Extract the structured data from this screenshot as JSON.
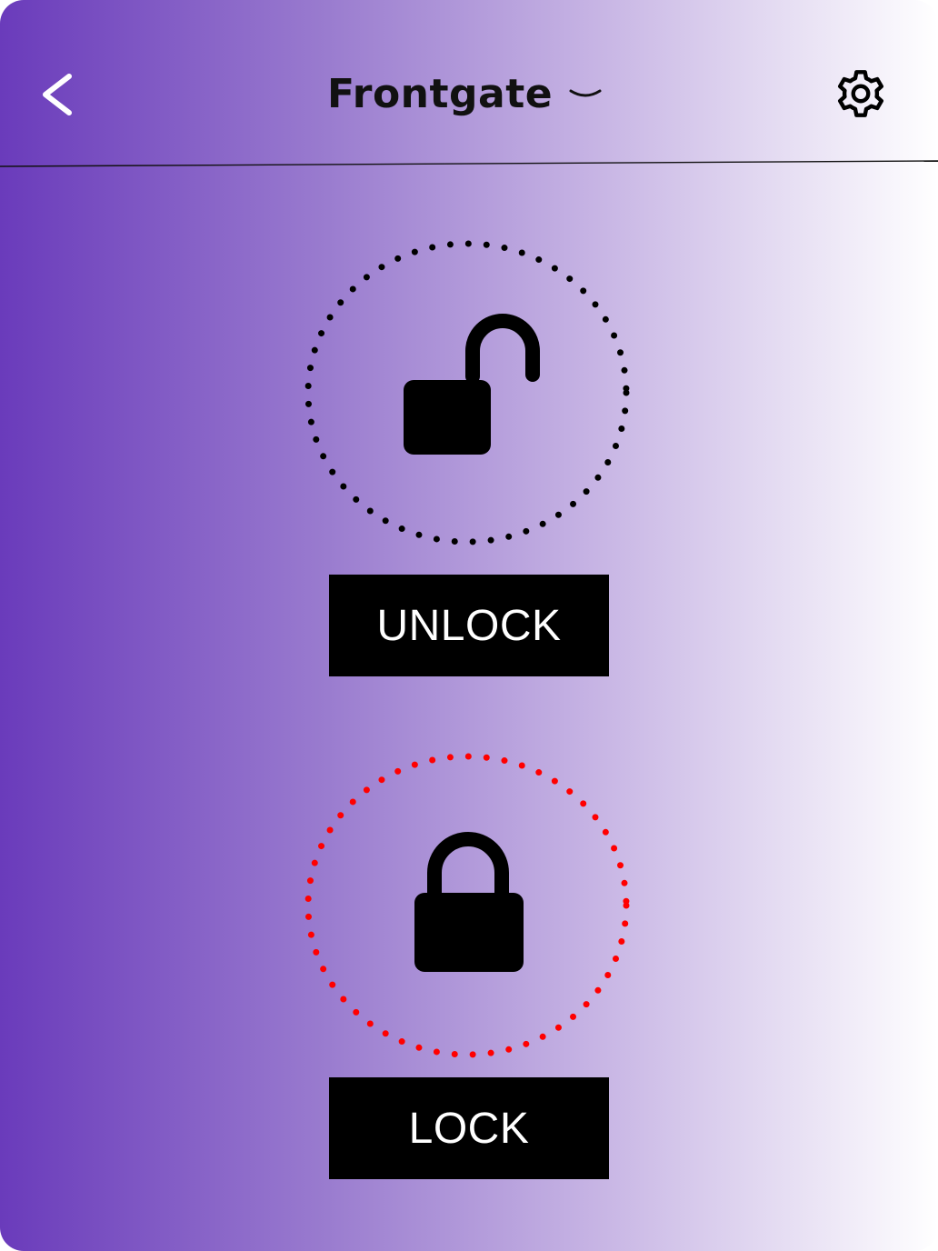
{
  "header": {
    "back_icon": "chevron-left-icon",
    "title": "Frontgate",
    "dropdown_icon": "chevron-down-icon",
    "settings_icon": "gear-icon"
  },
  "unlock": {
    "icon": "unlocked-padlock-icon",
    "ring_color": "#000000",
    "button_label": "UNLOCK"
  },
  "lock": {
    "icon": "locked-padlock-icon",
    "ring_color": "#ff0000",
    "button_label": "LOCK"
  },
  "colors": {
    "gradient_start": "#6a3bbb",
    "gradient_end": "#ffffff",
    "button_bg": "#000000",
    "button_text": "#ffffff"
  }
}
